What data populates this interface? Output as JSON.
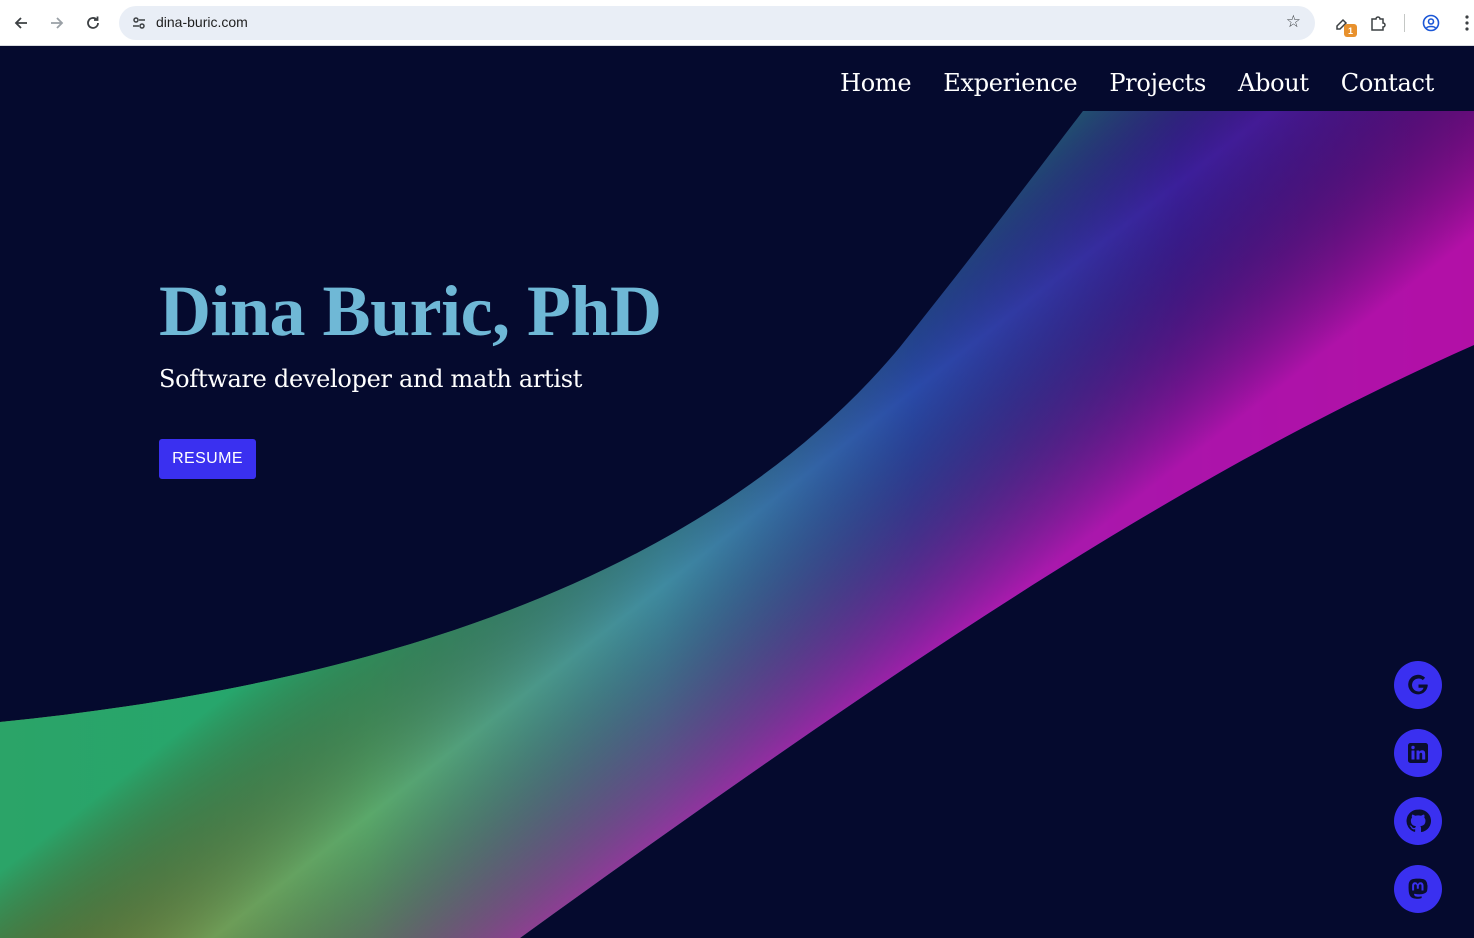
{
  "browser": {
    "url": "dina-buric.com",
    "extension_badge": "1"
  },
  "nav": {
    "items": [
      "Home",
      "Experience",
      "Projects",
      "About",
      "Contact"
    ]
  },
  "hero": {
    "title": "Dina Buric, PhD",
    "subtitle": "Software developer and math artist",
    "resume_label": "RESUME"
  },
  "socials": [
    {
      "icon": "google-icon"
    },
    {
      "icon": "linkedin-icon"
    },
    {
      "icon": "github-icon"
    },
    {
      "icon": "mastodon-icon"
    }
  ],
  "colors": {
    "background": "#050a2e",
    "title": "#6fb8d6",
    "accent": "#3a30f0",
    "ribbon_green": "#2ea66a",
    "ribbon_blue": "#1e3aa8",
    "ribbon_purple": "#7a14b8",
    "ribbon_magenta": "#c01ab0"
  }
}
